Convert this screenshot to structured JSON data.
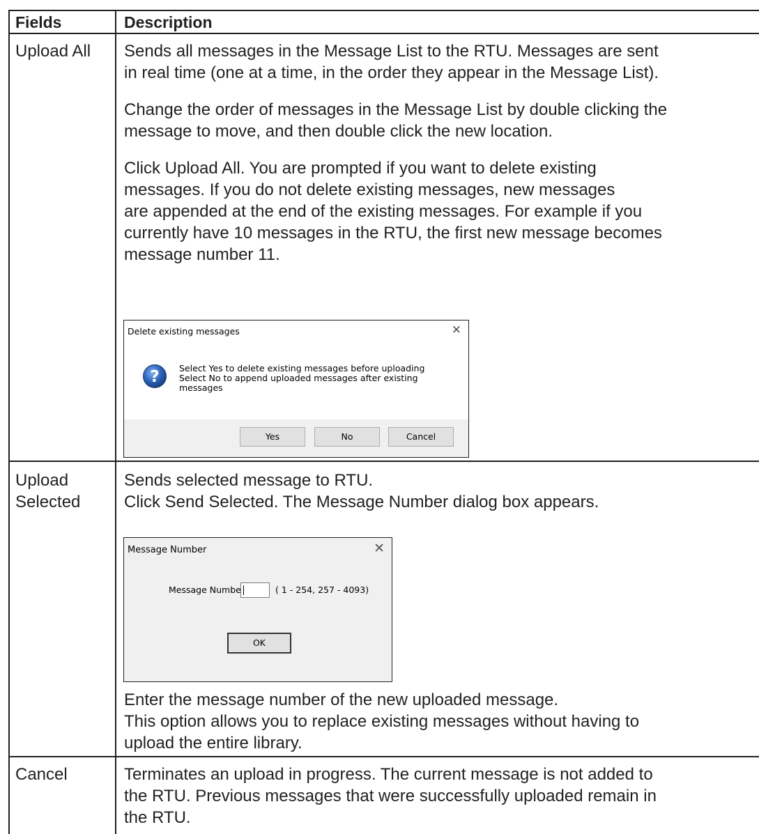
{
  "table": {
    "headers": {
      "fields": "Fields",
      "description": "Description"
    },
    "rows": [
      {
        "field": [
          "Upload All"
        ],
        "paragraphs": [
          [
            "Sends all messages in the Message List to the RTU. Messages are sent",
            "in real time (one at a time, in the order they appear in the Message List)."
          ],
          [
            "Change the order of messages in the Message List by double clicking the",
            "message to move, and then double click the new location."
          ],
          [
            "Click Upload All. You are prompted if you want to delete existing",
            "messages. If you do not delete existing messages, new messages",
            "are appended at the end of the existing messages. For example if you",
            "currently have 10 messages in the RTU, the first new message becomes",
            "message number 11."
          ]
        ]
      },
      {
        "field": [
          "Upload",
          "Selected"
        ],
        "paragraphs_top": [
          [
            "Sends selected message to RTU.",
            "Click Send Selected. The Message Number dialog box appears."
          ]
        ],
        "paragraphs_bottom": [
          [
            "Enter the message number of the new uploaded message.",
            "This option allows you to replace existing messages without having to",
            "upload the entire library."
          ]
        ]
      },
      {
        "field": [
          "Cancel"
        ],
        "paragraphs": [
          [
            "Terminates an upload in progress. The current message is not added to",
            "the RTU. Previous messages that were successfully uploaded remain in",
            "the RTU."
          ]
        ]
      }
    ]
  },
  "dialog_delete": {
    "title": "Delete existing messages",
    "close": "✕",
    "icon": "question-icon",
    "message": [
      "Select Yes to delete existing  messages before uploading",
      "Select No to append uploaded messages after existing",
      "messages"
    ],
    "buttons": {
      "yes": "Yes",
      "no": "No",
      "cancel": "Cancel"
    }
  },
  "dialog_number": {
    "title": "Message Number",
    "close": "✕",
    "label": "Message Number",
    "input_value": "",
    "range": "( 1 - 254,  257 - 4093)",
    "ok": "OK"
  }
}
